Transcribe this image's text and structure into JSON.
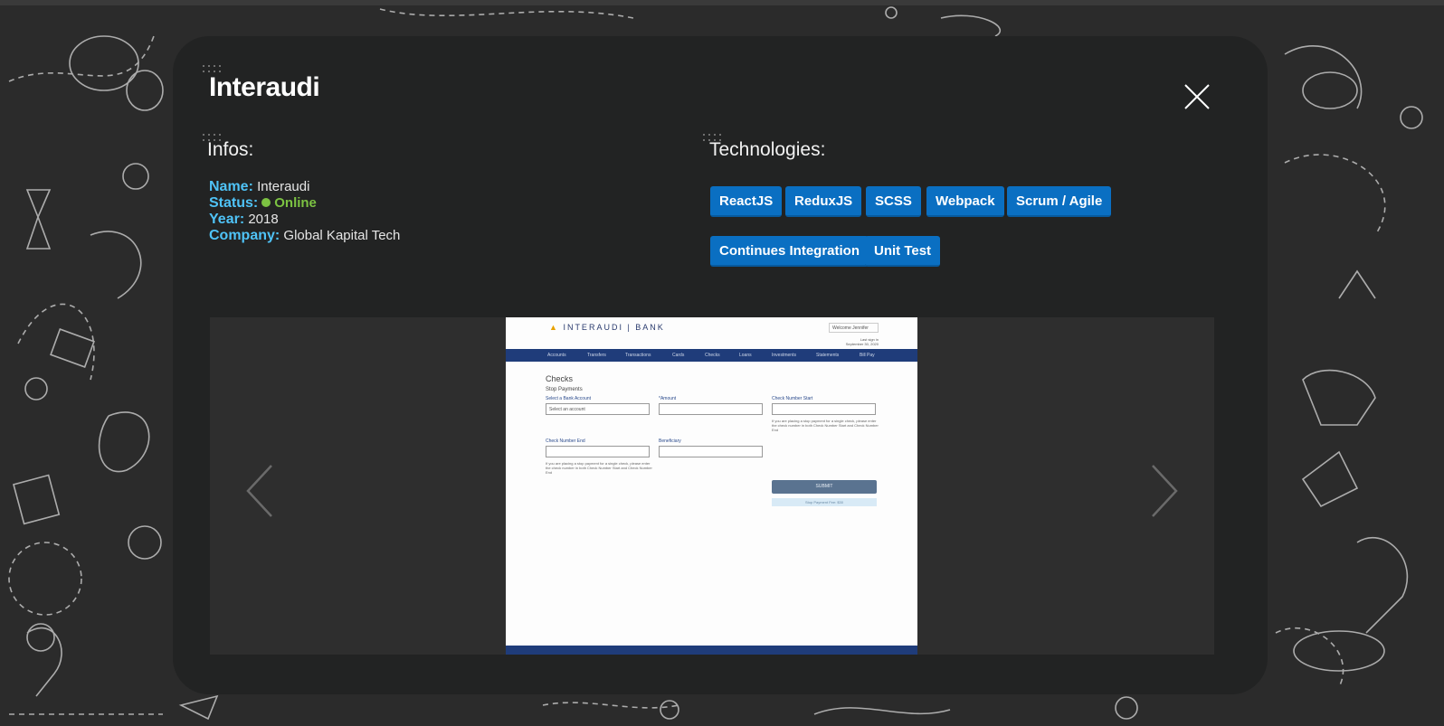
{
  "modal": {
    "title": "Interaudi",
    "close_icon": "close-icon"
  },
  "infos": {
    "heading": "Infos:",
    "name_label": "Name:",
    "name_value": "Interaudi",
    "status_label": "Status:",
    "status_value": "Online",
    "year_label": "Year:",
    "year_value": "2018",
    "company_label": "Company:",
    "company_value": "Global Kapital Tech"
  },
  "technologies": {
    "heading": "Technologies:",
    "tags": [
      "ReactJS",
      "ReduxJS",
      "SCSS",
      "Webpack",
      "Scrum / Agile",
      "Continues Integration",
      "Unit Test"
    ]
  },
  "carousel": {
    "prev_icon": "chevron-left-icon",
    "next_icon": "chevron-right-icon",
    "slide": {
      "logo_text": "INTERAUDI",
      "logo_suffix": "BANK",
      "welcome": "Welcome Jennifer",
      "last_login": "Last sign in",
      "last_login_date": "September 30, 2020",
      "nav": [
        "Accounts",
        "Transfers",
        "Transactions",
        "Cards",
        "Checks",
        "Loans",
        "Investments",
        "Statements",
        "Bill Pay"
      ],
      "page_title": "Checks",
      "section_title": "Stop Payments",
      "label_account": "Select a Bank Account",
      "placeholder_account": "Select an account",
      "label_amount": "*Amount",
      "label_check_start": "Check Number Start",
      "hint_start": "If you are placing a stop payment for a single check, please enter the check number in both Check Number Start and Check Number End",
      "label_check_end": "Check Number End",
      "label_beneficiary": "Beneficiary",
      "hint_end": "If you are placing a stop payment for a single check, please enter the check number in both Check Number Start and Check Number End",
      "submit": "SUBMIT",
      "fee": "Stop Payment Fee: $30"
    }
  },
  "colors": {
    "accent": "#4fc3f7",
    "tag_bg": "#0a6fc2",
    "online": "#7cc242",
    "modal_bg": "#222323"
  }
}
